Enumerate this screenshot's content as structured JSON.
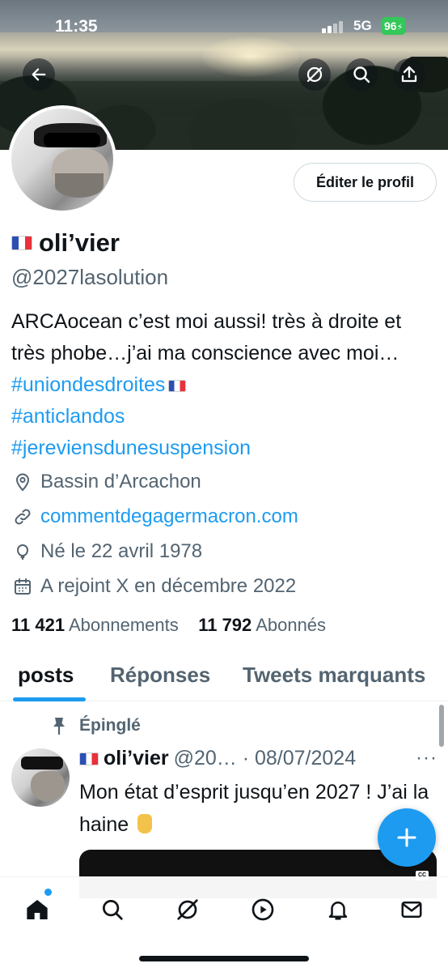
{
  "status_bar": {
    "time": "11:35",
    "network": "5G",
    "battery": "96"
  },
  "header": {
    "back_icon": "arrow-left-icon",
    "actions": [
      "grok-icon",
      "search-icon",
      "share-icon"
    ]
  },
  "profile": {
    "edit_button": "Éditer le profil",
    "name": "oli’vier",
    "handle": "@2027lasolution",
    "bio": {
      "text1": "ARCAocean c’est moi aussi! très à droite et très phobe…j’ai ma conscience avec moi…",
      "tag1": "#uniondesdroites",
      "tag2": "#anticlandos",
      "tag3": "#jereviensdunesuspension"
    },
    "location": "Bassin d’Arcachon",
    "website": "commentdegagermacron.com",
    "birthday": "Né le 22 avril 1978",
    "joined": "A rejoint X en décembre 2022",
    "following_count": "11 421",
    "following_label": "Abonnements",
    "followers_count": "11 792",
    "followers_label": "Abonnés"
  },
  "tabs": [
    {
      "label": "posts",
      "active": true
    },
    {
      "label": "Réponses",
      "active": false
    },
    {
      "label": "Tweets marquants",
      "active": false
    }
  ],
  "post": {
    "pinned_label": "Épinglé",
    "name": "oli’vier",
    "handle_date": "@20… · 08/07/2024",
    "more": "···",
    "text": "Mon état d’esprit jusqu’en 2027 ! J’ai la haine",
    "media_badge": "CC"
  },
  "bottom_nav": [
    "home-icon",
    "search-icon",
    "grok-icon",
    "video-icon",
    "notifications-icon",
    "messages-icon"
  ],
  "colors": {
    "accent": "#1d9bf0",
    "text": "#0f1419",
    "secondary": "#536471"
  }
}
